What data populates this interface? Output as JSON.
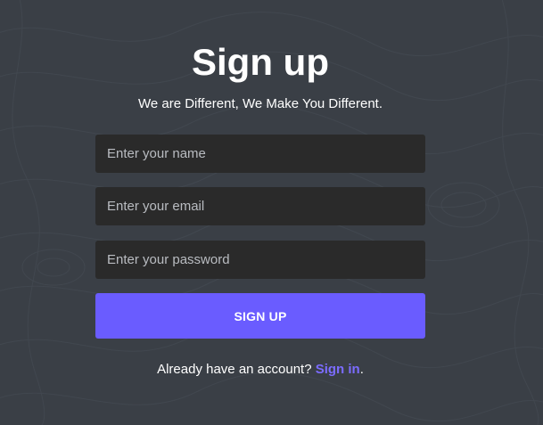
{
  "heading": {
    "title": "Sign up",
    "subtitle": "We are Different, We Make You Different."
  },
  "form": {
    "name_placeholder": "Enter your name",
    "email_placeholder": "Enter your email",
    "password_placeholder": "Enter your password",
    "submit_label": "SIGN UP"
  },
  "footer": {
    "prompt": "Already have an account?",
    "link_label": "Sign in",
    "suffix": "."
  },
  "colors": {
    "background": "#3a3f46",
    "input_background": "#2a2a2a",
    "accent": "#6a5cff",
    "link": "#7b6cff"
  }
}
